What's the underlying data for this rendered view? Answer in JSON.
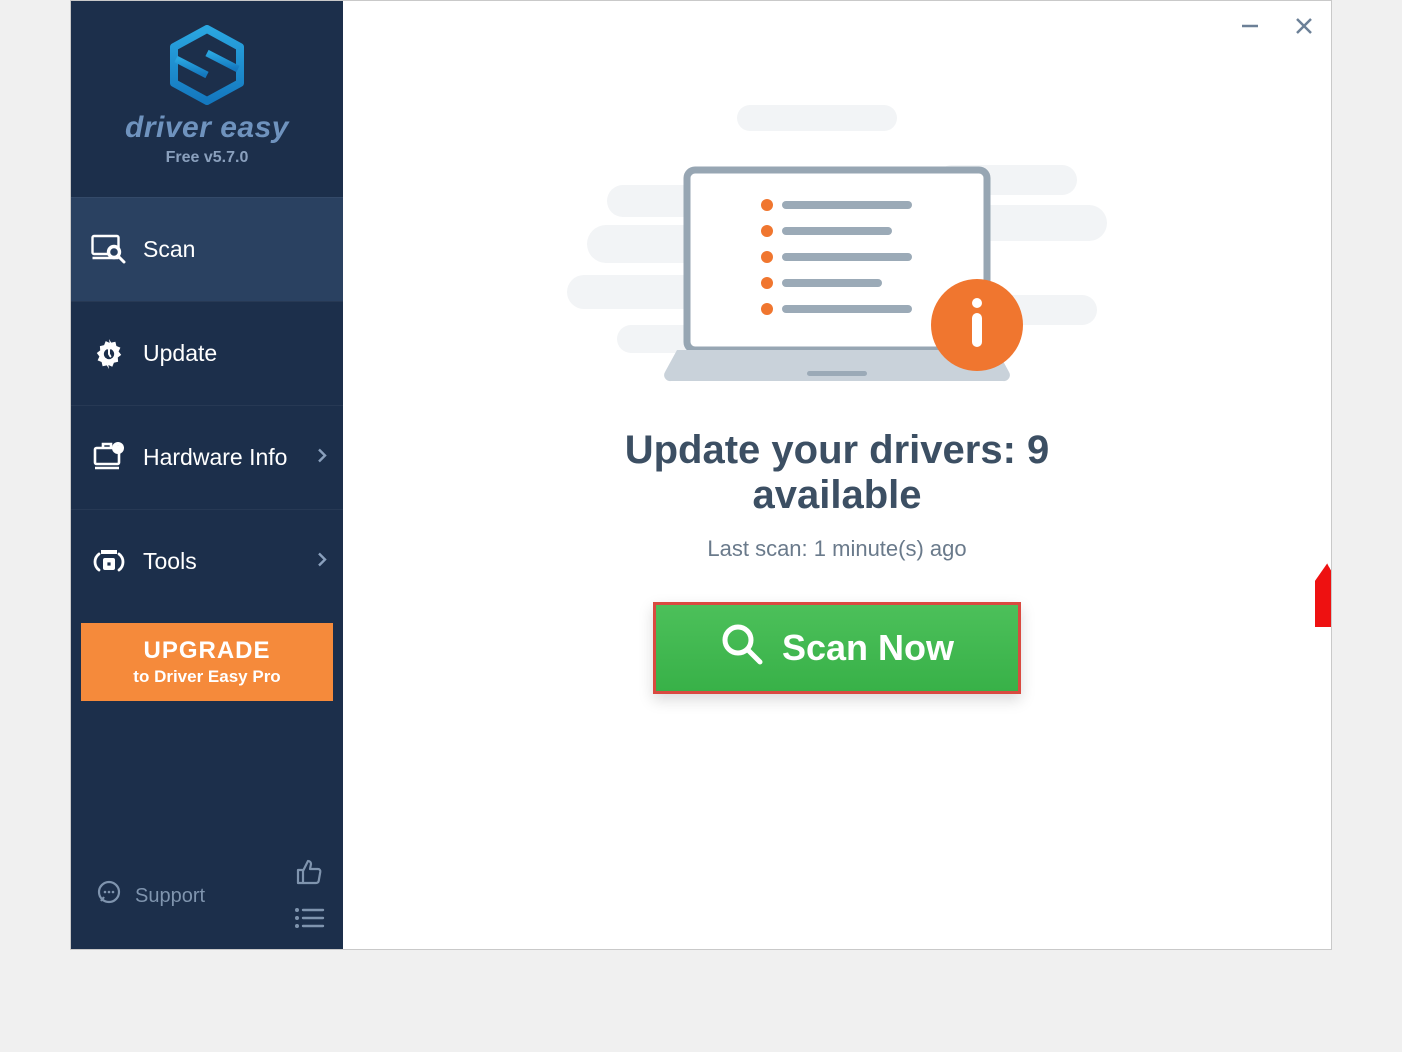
{
  "brand": {
    "name": "driver easy",
    "version": "Free v5.7.0"
  },
  "sidebar": {
    "items": [
      {
        "label": "Scan",
        "icon": "monitor-search-icon",
        "active": true,
        "chevron": false
      },
      {
        "label": "Update",
        "icon": "gear-icon",
        "active": false,
        "chevron": false
      },
      {
        "label": "Hardware Info",
        "icon": "hardware-info-icon",
        "active": false,
        "chevron": true
      },
      {
        "label": "Tools",
        "icon": "tools-icon",
        "active": false,
        "chevron": true
      }
    ],
    "upgrade": {
      "line1": "UPGRADE",
      "line2": "to Driver Easy Pro"
    },
    "support_label": "Support"
  },
  "main": {
    "headline": "Update your drivers: 9 available",
    "subline": "Last scan: 1 minute(s) ago",
    "scan_button_label": "Scan Now"
  },
  "colors": {
    "sidebar_bg": "#1c2f4b",
    "accent_orange": "#f58a3b",
    "scan_green": "#3fb94e",
    "info_orange": "#f0762f",
    "text_dark": "#3c4f63"
  }
}
